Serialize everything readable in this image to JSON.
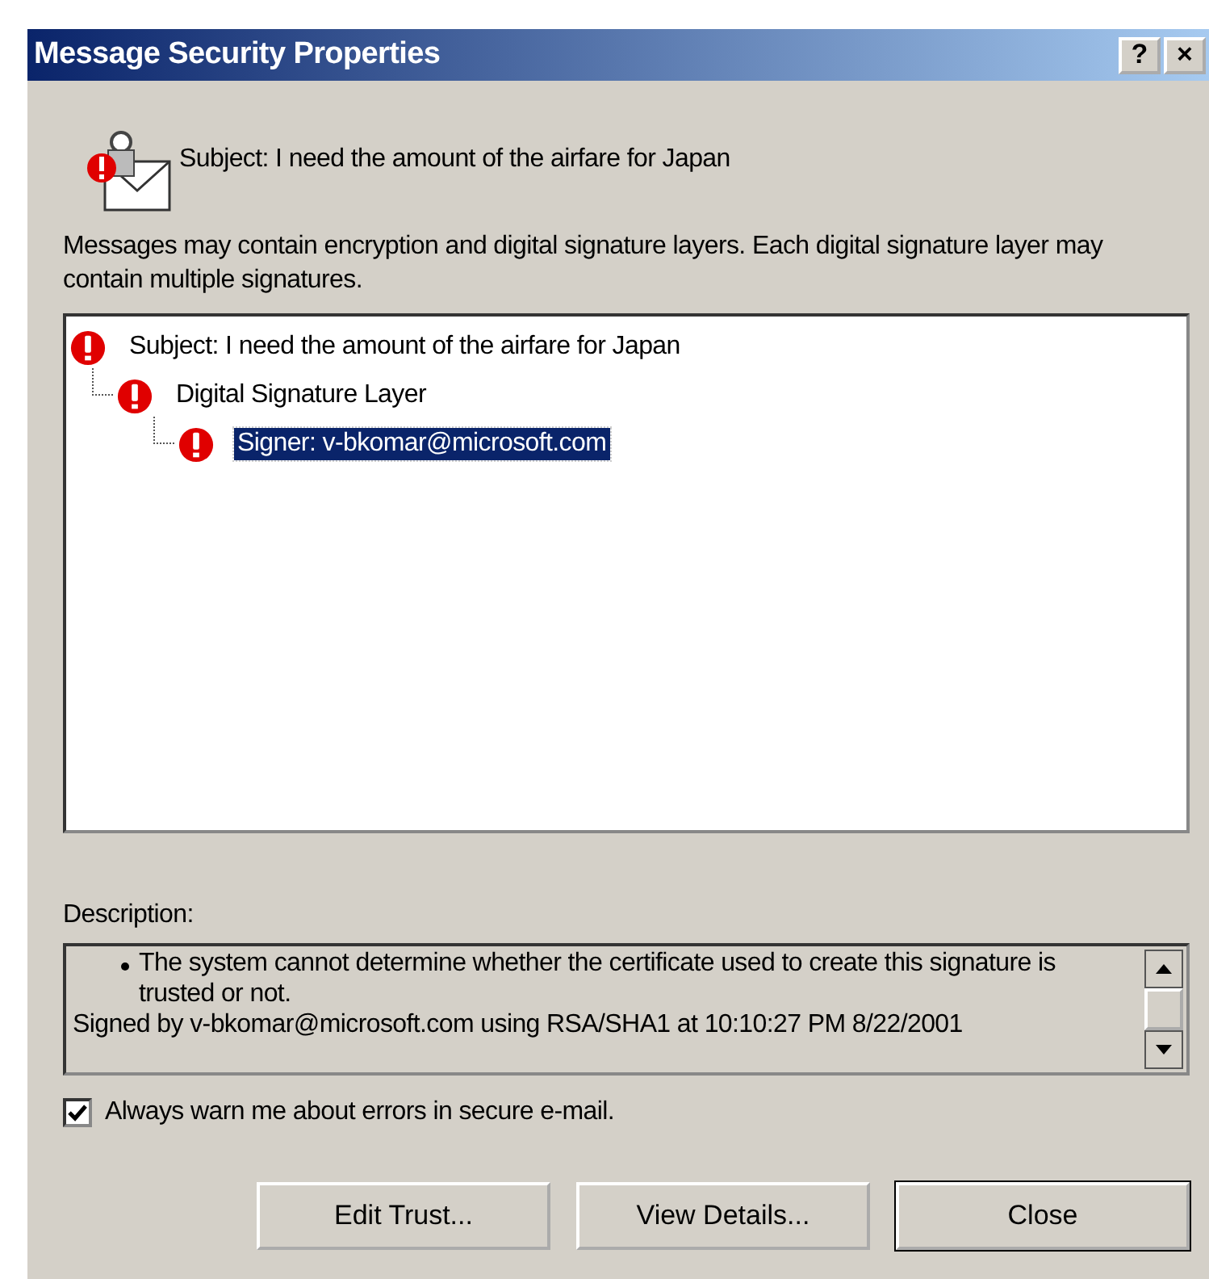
{
  "window": {
    "title": "Message Security Properties",
    "help_button": "?",
    "close_button": "×"
  },
  "header": {
    "subject": "Subject: I need the amount of the airfare for Japan"
  },
  "intro": "Messages may contain encryption and digital signature layers.  Each digital signature layer may contain multiple signatures.",
  "tree": [
    {
      "label": "Subject: I need the amount of the airfare for Japan",
      "selected": false,
      "children": [
        {
          "label": "Digital Signature Layer",
          "selected": false,
          "children": [
            {
              "label": "Signer: v-bkomar@microsoft.com",
              "selected": true
            }
          ]
        }
      ]
    }
  ],
  "description": {
    "label": "Description:",
    "lines": [
      {
        "kind": "bullet",
        "text": "The system cannot determine whether the certificate used to create this signature is trusted or not."
      },
      {
        "kind": "plain",
        "text": "Signed by v-bkomar@microsoft.com using RSA/SHA1 at 10:10:27 PM 8/22/2001"
      }
    ]
  },
  "always_warn": {
    "label": "Always warn me about errors in secure e-mail.",
    "checked": true
  },
  "buttons": [
    {
      "label": "Edit Trust...",
      "default": false
    },
    {
      "label": "View Details...",
      "default": false
    },
    {
      "label": "Close",
      "default": true
    }
  ]
}
